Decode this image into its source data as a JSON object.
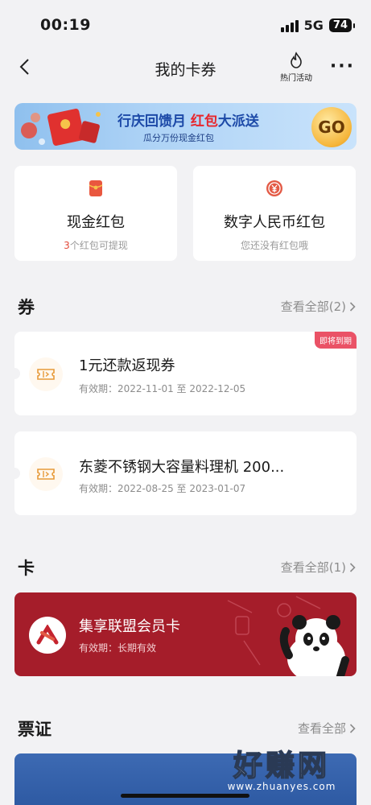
{
  "status_bar": {
    "time": "00:19",
    "network": "5G",
    "battery": "74"
  },
  "nav": {
    "title": "我的卡券",
    "hot_label": "热门活动"
  },
  "banner": {
    "title_pre": "行庆回馈月 ",
    "title_red": "红包",
    "title_post": "大派送",
    "subtitle": "瓜分万份现金红包",
    "go_label": "GO"
  },
  "wallets": [
    {
      "title": "现金红包",
      "sub_highlight": "3",
      "sub_rest": "个红包可提现"
    },
    {
      "title": "数字人民币红包",
      "sub_highlight": "",
      "sub_rest": "您还没有红包哦"
    }
  ],
  "coupons_section": {
    "title": "券",
    "more": "查看全部(2)"
  },
  "coupons": [
    {
      "name": "1元还款返现券",
      "date": "有效期：2022-11-01 至 2022-12-05",
      "tag": "即将到期"
    },
    {
      "name": "东菱不锈钢大容量料理机 200...",
      "date": "有效期：2022-08-25 至 2023-01-07",
      "tag": ""
    }
  ],
  "cards_section": {
    "title": "卡",
    "more": "查看全部(1)"
  },
  "member_card": {
    "name": "集享联盟会员卡",
    "date": "有效期：长期有效"
  },
  "tickets_section": {
    "title": "票证",
    "more": "查看全部"
  },
  "watermark": {
    "main": "好赚网",
    "sub": "www.zhuanyes.com"
  },
  "colors": {
    "accent_red": "#a51d2a",
    "tag_pink": "#ea5266",
    "banner_blue": "#aed3f6"
  }
}
